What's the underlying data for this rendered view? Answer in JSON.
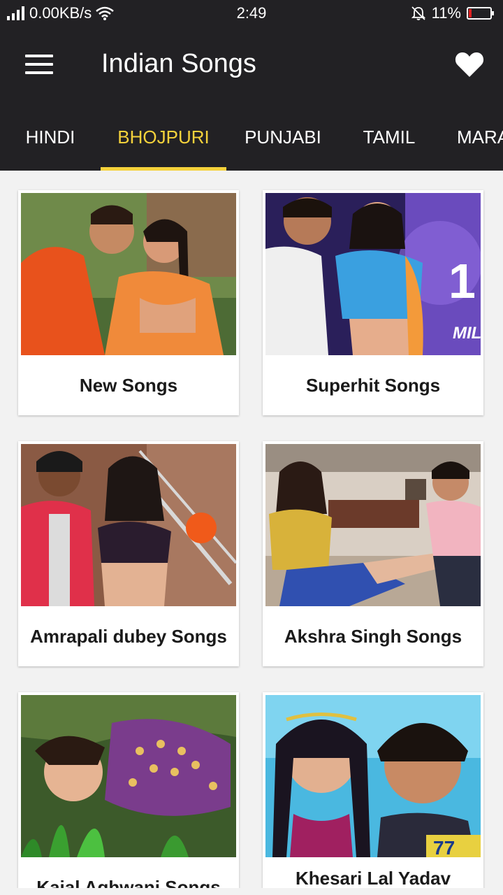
{
  "status_bar": {
    "network_speed": "0.00KB/s",
    "time": "2:49",
    "battery": "11%"
  },
  "app_bar": {
    "title": "Indian Songs"
  },
  "tabs": [
    {
      "label": "HINDI"
    },
    {
      "label": "BHOJPURI"
    },
    {
      "label": "PUNJABI"
    },
    {
      "label": "TAMIL"
    },
    {
      "label": "MARA"
    }
  ],
  "active_tab": "BHOJPURI",
  "cards": [
    {
      "label": "New Songs"
    },
    {
      "label": "Superhit Songs"
    },
    {
      "label": "Amrapali dubey Songs"
    },
    {
      "label": "Akshra Singh Songs"
    },
    {
      "label": "Kajal Aghwani Songs"
    },
    {
      "label": "Khesari Lal Yadav"
    }
  ],
  "colors": {
    "bar_background": "#222124",
    "accent": "#f5d23b",
    "page_background": "#f2f2f2",
    "battery_low": "#e02020"
  }
}
